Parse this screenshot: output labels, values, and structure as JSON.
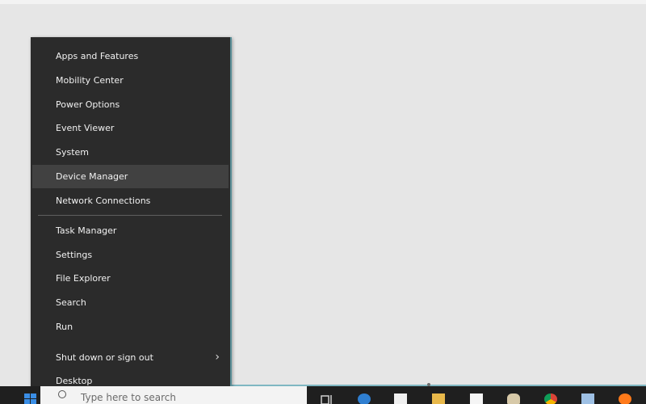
{
  "context_menu": {
    "items": [
      {
        "label": "Apps and Features"
      },
      {
        "label": "Mobility Center"
      },
      {
        "label": "Power Options"
      },
      {
        "label": "Event Viewer"
      },
      {
        "label": "System"
      },
      {
        "label": "Device Manager",
        "highlighted": true
      },
      {
        "label": "Network Connections"
      },
      {
        "label": "Task Manager"
      },
      {
        "label": "Settings"
      },
      {
        "label": "File Explorer"
      },
      {
        "label": "Search"
      },
      {
        "label": "Run"
      },
      {
        "label": "Shut down or sign out",
        "has_submenu": true
      },
      {
        "label": "Desktop"
      }
    ]
  },
  "taskbar": {
    "search_placeholder": "Type here to search",
    "icons": [
      "windows-start-icon",
      "task-view-icon",
      "edge-icon",
      "store-icon",
      "file-explorer-icon",
      "mail-icon",
      "paint-icon",
      "chrome-icon",
      "pen-icon",
      "firefox-icon"
    ]
  },
  "colors": {
    "menu_bg": "#2b2b2b",
    "menu_hover": "#414141",
    "menu_text": "#f1f1f1",
    "taskbar_bg": "#1f1f1f",
    "desktop_bg": "#e6e6e6",
    "accent_edge": "#5a8f98"
  }
}
